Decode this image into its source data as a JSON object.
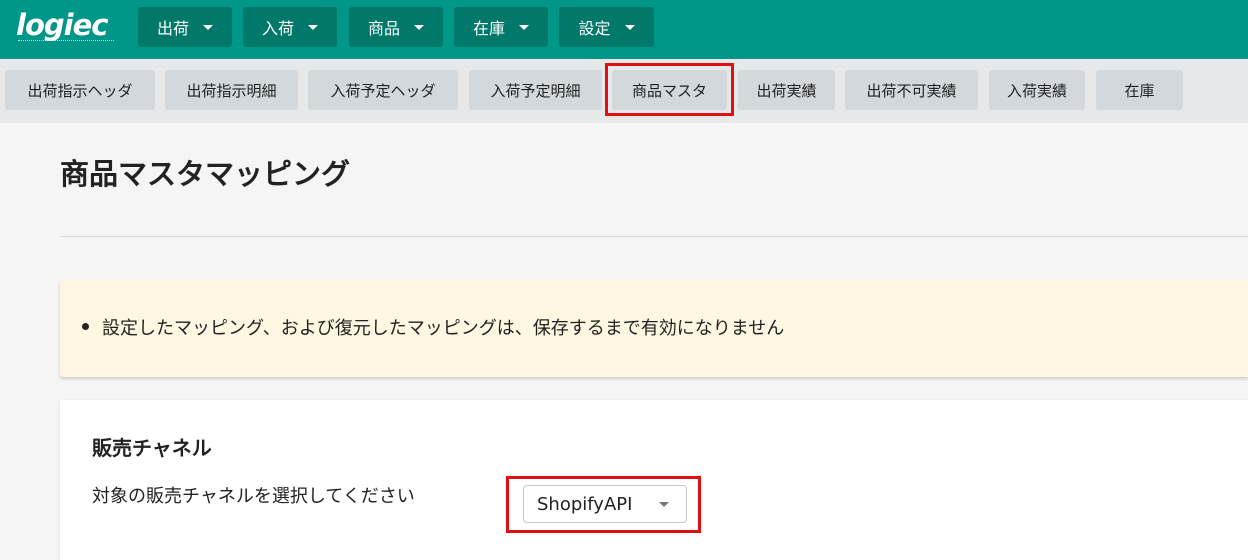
{
  "app": {
    "logo": "logiec"
  },
  "top_menu": [
    {
      "label": "出荷"
    },
    {
      "label": "入荷"
    },
    {
      "label": "商品"
    },
    {
      "label": "在庫"
    },
    {
      "label": "設定"
    }
  ],
  "sub_nav": [
    {
      "label": "出荷指示ヘッダ"
    },
    {
      "label": "出荷指示明細"
    },
    {
      "label": "入荷予定ヘッダ"
    },
    {
      "label": "入荷予定明細"
    },
    {
      "label": "商品マスタ"
    },
    {
      "label": "出荷実績"
    },
    {
      "label": "出荷不可実績"
    },
    {
      "label": "入荷実績"
    },
    {
      "label": "在庫"
    }
  ],
  "page": {
    "title": "商品マスタマッピング"
  },
  "notice": {
    "items": [
      "設定したマッピング、および復元したマッピングは、保存するまで有効になりません"
    ]
  },
  "sales_channel": {
    "title": "販売チャネル",
    "label": "対象の販売チャネルを選択してください",
    "selected": "ShopifyAPI"
  },
  "colors": {
    "header_bg": "#009688",
    "menu_btn_bg": "#00796b",
    "highlight": "#e01010",
    "notice_bg": "#fdf6e0"
  }
}
